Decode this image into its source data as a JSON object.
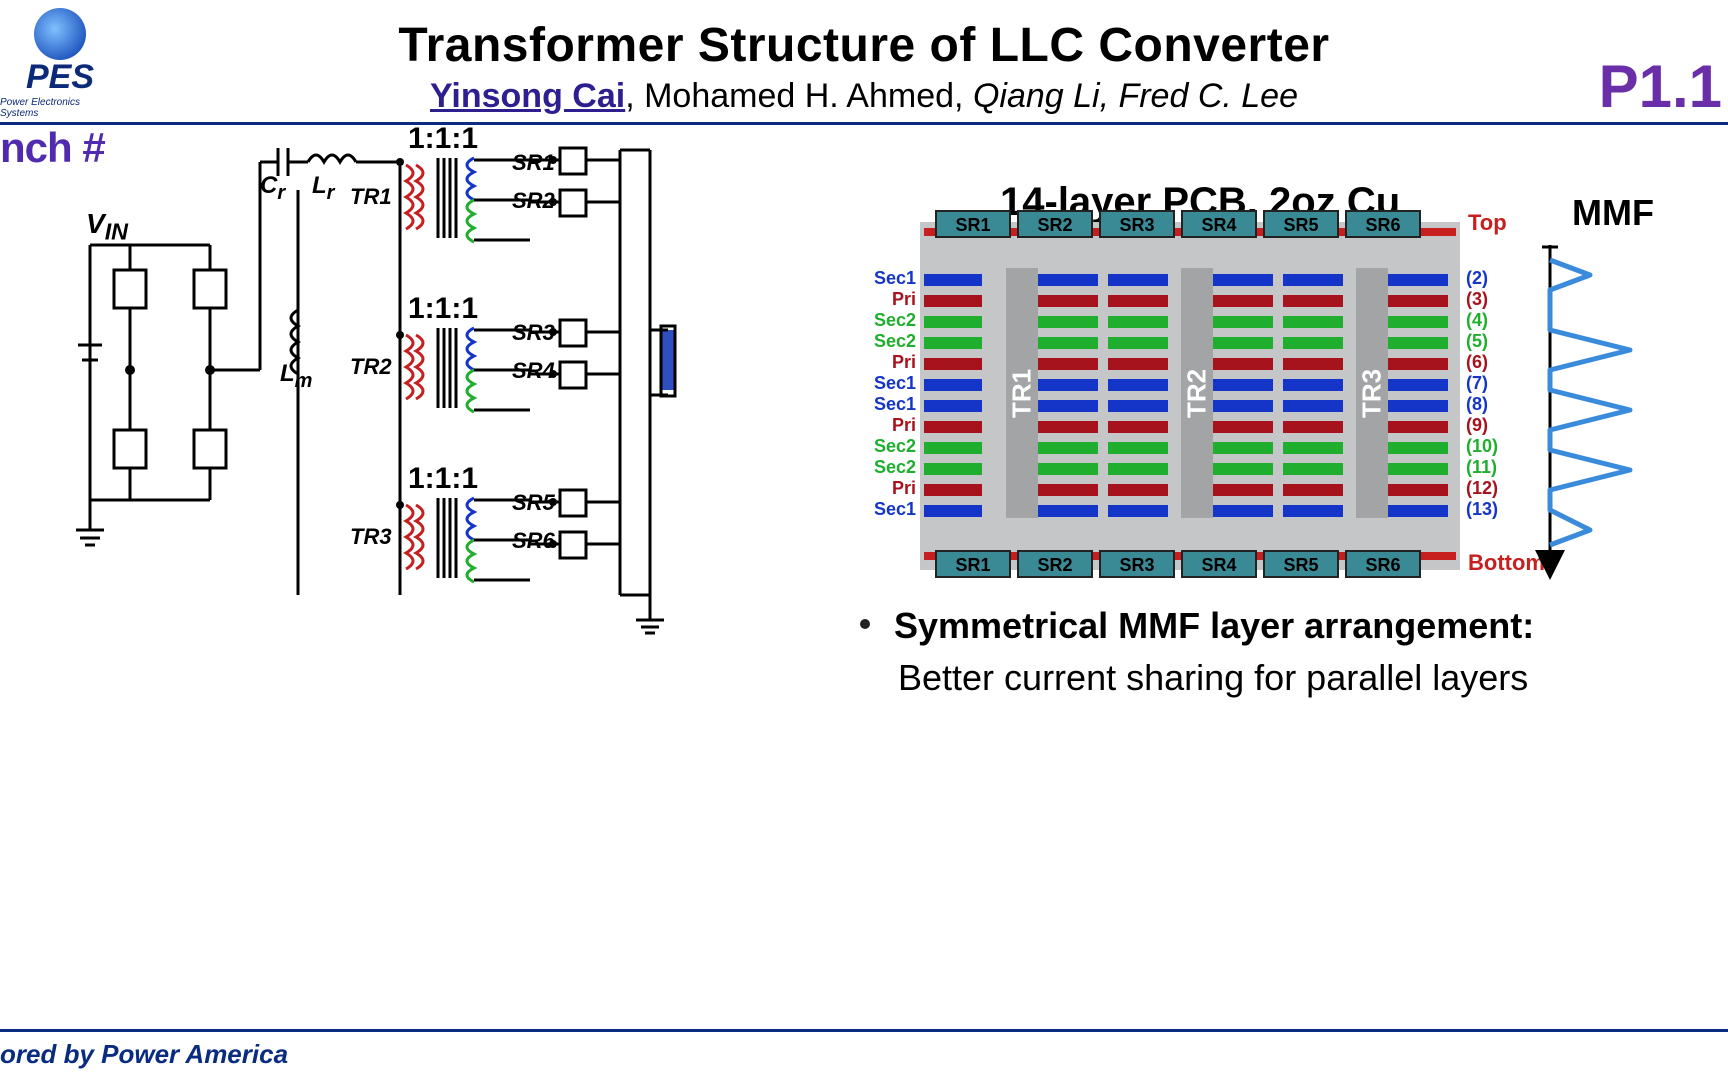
{
  "logo": {
    "text": "PES",
    "sub": "Power Electronics Systems"
  },
  "title": "Transformer Structure of LLC Converter",
  "authors": {
    "first": "Yinsong Cai",
    "rest_plain": ", Mohamed H. Ahmed, ",
    "rest_italic": "Qiang Li, Fred C. Lee"
  },
  "page_id": "P1.1",
  "bench": "nch #",
  "circuit": {
    "vin": "V",
    "vin_sub": "IN",
    "cr": "C",
    "lr": "L",
    "lm": "L",
    "sub_r": "r",
    "sub_m": "m",
    "tr1": "TR1",
    "tr2": "TR2",
    "tr3": "TR3",
    "ratio": "1:1:1",
    "sr": [
      "SR1",
      "SR2",
      "SR3",
      "SR4",
      "SR5",
      "SR6"
    ]
  },
  "pcb": {
    "title": "14-layer PCB, 2oz Cu",
    "mmf_title": "MMF",
    "sr_top": [
      "SR1",
      "SR2",
      "SR3",
      "SR4",
      "SR5",
      "SR6"
    ],
    "sr_bottom": [
      "SR1",
      "SR2",
      "SR3",
      "SR4",
      "SR5",
      "SR6"
    ],
    "top_label": "Top",
    "bottom_label": "Bottom",
    "core_labels": [
      "TR1",
      "TR2",
      "TR3"
    ],
    "layers": [
      {
        "name": "Sec1",
        "color": "#1535c8",
        "num": "(2)"
      },
      {
        "name": "Pri",
        "color": "#a7131c",
        "num": "(3)"
      },
      {
        "name": "Sec2",
        "color": "#1fae2d",
        "num": "(4)"
      },
      {
        "name": "Sec2",
        "color": "#1fae2d",
        "num": "(5)"
      },
      {
        "name": "Pri",
        "color": "#a7131c",
        "num": "(6)"
      },
      {
        "name": "Sec1",
        "color": "#1535c8",
        "num": "(7)"
      },
      {
        "name": "Sec1",
        "color": "#1535c8",
        "num": "(8)"
      },
      {
        "name": "Pri",
        "color": "#a7131c",
        "num": "(9)"
      },
      {
        "name": "Sec2",
        "color": "#1fae2d",
        "num": "(10)"
      },
      {
        "name": "Sec2",
        "color": "#1fae2d",
        "num": "(11)"
      },
      {
        "name": "Pri",
        "color": "#a7131c",
        "num": "(12)"
      },
      {
        "name": "Sec1",
        "color": "#1535c8",
        "num": "(13)"
      }
    ]
  },
  "bullet": {
    "bold": "Symmetrical MMF layer arrangement:",
    "text": "Better current sharing for parallel layers"
  },
  "footer": "ored  by Power America"
}
